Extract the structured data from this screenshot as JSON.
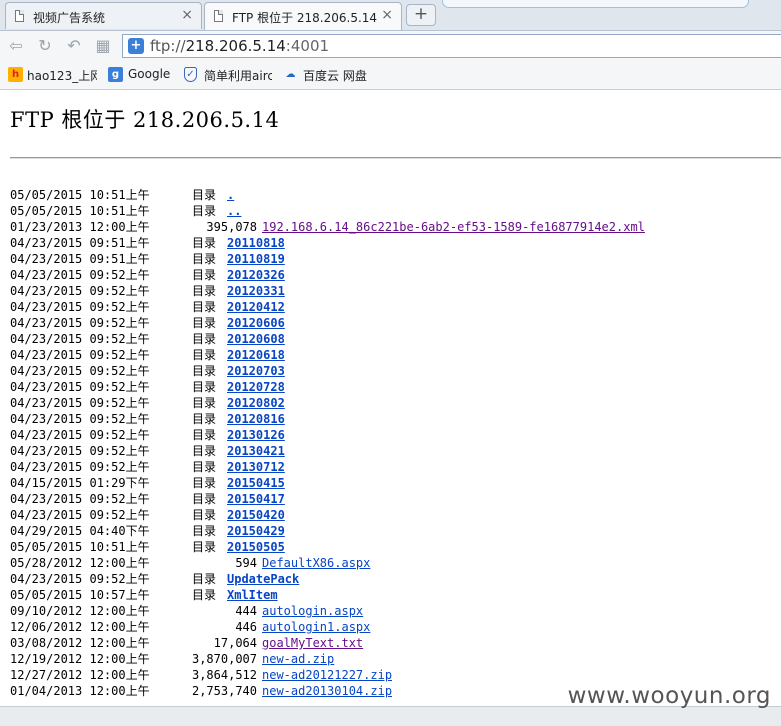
{
  "tabs": [
    {
      "title": "视频广告系统",
      "close": "×"
    },
    {
      "title": "FTP 根位于 218.206.5.14",
      "close": "×"
    }
  ],
  "new_tab_label": "+",
  "address": {
    "scheme": "ftp://",
    "host": "218.206.5.14",
    "port": ":4001"
  },
  "bookmarks": [
    "hao123_上网",
    "Google",
    "简单利用airc",
    "百度云 网盘"
  ],
  "page": {
    "title": "FTP 根位于 218.206.5.14",
    "dir_label": "目录",
    "entries": [
      {
        "date": "05/05/2015 10:51上午",
        "type": "dir",
        "size": "",
        "name": "."
      },
      {
        "date": "05/05/2015 10:51上午",
        "type": "dir",
        "size": "",
        "name": ".."
      },
      {
        "date": "01/23/2013 12:00上午",
        "type": "file",
        "size": "395,078",
        "name": "192.168.6.14_86c221be-6ab2-ef53-1589-fe16877914e2.xml",
        "visited": true
      },
      {
        "date": "04/23/2015 09:51上午",
        "type": "dir",
        "size": "",
        "name": "20110818"
      },
      {
        "date": "04/23/2015 09:51上午",
        "type": "dir",
        "size": "",
        "name": "20110819"
      },
      {
        "date": "04/23/2015 09:52上午",
        "type": "dir",
        "size": "",
        "name": "20120326"
      },
      {
        "date": "04/23/2015 09:52上午",
        "type": "dir",
        "size": "",
        "name": "20120331"
      },
      {
        "date": "04/23/2015 09:52上午",
        "type": "dir",
        "size": "",
        "name": "20120412"
      },
      {
        "date": "04/23/2015 09:52上午",
        "type": "dir",
        "size": "",
        "name": "20120606"
      },
      {
        "date": "04/23/2015 09:52上午",
        "type": "dir",
        "size": "",
        "name": "20120608"
      },
      {
        "date": "04/23/2015 09:52上午",
        "type": "dir",
        "size": "",
        "name": "20120618"
      },
      {
        "date": "04/23/2015 09:52上午",
        "type": "dir",
        "size": "",
        "name": "20120703"
      },
      {
        "date": "04/23/2015 09:52上午",
        "type": "dir",
        "size": "",
        "name": "20120728"
      },
      {
        "date": "04/23/2015 09:52上午",
        "type": "dir",
        "size": "",
        "name": "20120802"
      },
      {
        "date": "04/23/2015 09:52上午",
        "type": "dir",
        "size": "",
        "name": "20120816"
      },
      {
        "date": "04/23/2015 09:52上午",
        "type": "dir",
        "size": "",
        "name": "20130126"
      },
      {
        "date": "04/23/2015 09:52上午",
        "type": "dir",
        "size": "",
        "name": "20130421"
      },
      {
        "date": "04/23/2015 09:52上午",
        "type": "dir",
        "size": "",
        "name": "20130712"
      },
      {
        "date": "04/15/2015 01:29下午",
        "type": "dir",
        "size": "",
        "name": "20150415"
      },
      {
        "date": "04/23/2015 09:52上午",
        "type": "dir",
        "size": "",
        "name": "20150417"
      },
      {
        "date": "04/23/2015 09:52上午",
        "type": "dir",
        "size": "",
        "name": "20150420"
      },
      {
        "date": "04/29/2015 04:40下午",
        "type": "dir",
        "size": "",
        "name": "20150429"
      },
      {
        "date": "05/05/2015 10:51上午",
        "type": "dir",
        "size": "",
        "name": "20150505"
      },
      {
        "date": "05/28/2012 12:00上午",
        "type": "file",
        "size": "594",
        "name": "DefaultX86.aspx"
      },
      {
        "date": "04/23/2015 09:52上午",
        "type": "dir",
        "size": "",
        "name": "UpdatePack"
      },
      {
        "date": "05/05/2015 10:57上午",
        "type": "dir",
        "size": "",
        "name": "XmlItem"
      },
      {
        "date": "09/10/2012 12:00上午",
        "type": "file",
        "size": "444",
        "name": "autologin.aspx"
      },
      {
        "date": "12/06/2012 12:00上午",
        "type": "file",
        "size": "446",
        "name": "autologin1.aspx"
      },
      {
        "date": "03/08/2012 12:00上午",
        "type": "file",
        "size": "17,064",
        "name": "goalMyText.txt",
        "visited": true
      },
      {
        "date": "12/19/2012 12:00上午",
        "type": "file",
        "size": "3,870,007",
        "name": "new-ad.zip"
      },
      {
        "date": "12/27/2012 12:00上午",
        "type": "file",
        "size": "3,864,512",
        "name": "new-ad20121227.zip"
      },
      {
        "date": "01/04/2013 12:00上午",
        "type": "file",
        "size": "2,753,740",
        "name": "new-ad20130104.zip"
      }
    ]
  },
  "watermark": "www.wooyun.org"
}
